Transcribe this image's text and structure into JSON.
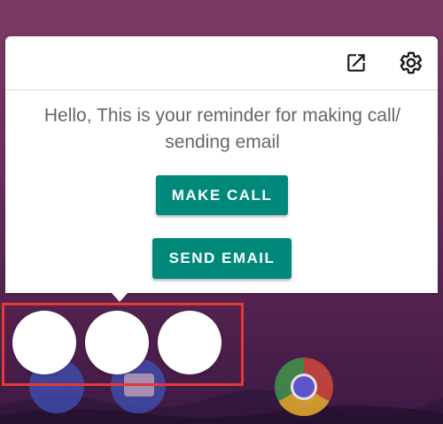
{
  "popup": {
    "icons": {
      "open_external": "open-in-new-icon",
      "settings": "settings-gear-icon"
    },
    "message": "Hello, This is your reminder for making call/ sending email",
    "make_call_label": "MAKE CALL",
    "send_email_label": "SEND EMAIL"
  },
  "colors": {
    "accent": "#00897b",
    "highlight_border": "#e53935",
    "wallpaper": "#6a2f5a"
  },
  "bubbles": [
    "bubble-1",
    "bubble-2",
    "bubble-3"
  ],
  "dock": {
    "apps": [
      "phone-app-icon",
      "messages-app-icon",
      "chrome-app-icon"
    ]
  }
}
